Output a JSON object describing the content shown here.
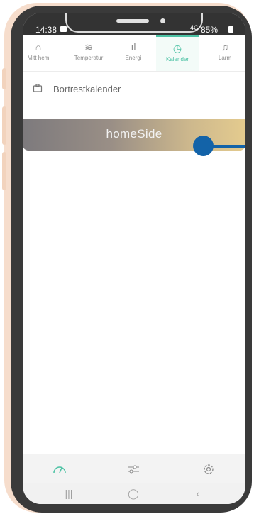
{
  "status_bar": {
    "time": "14:38",
    "signal": "4G",
    "battery": "85%"
  },
  "top_tabs": [
    {
      "label": "Mitt hem",
      "icon": "home-icon"
    },
    {
      "label": "Temperatur",
      "icon": "heat-waves-icon"
    },
    {
      "label": "Energi",
      "icon": "bar-chart-icon"
    },
    {
      "label": "Kalender",
      "icon": "clock-icon",
      "active": true
    },
    {
      "label": "Larm",
      "icon": "bell-icon"
    }
  ],
  "section": {
    "title": "Bortrestkalender",
    "icon": "briefcase-icon"
  },
  "banner": {
    "logo": "homeSide"
  },
  "bottom_nav": [
    {
      "icon": "gauge-icon",
      "glyph": "◜",
      "active": true
    },
    {
      "icon": "sliders-icon",
      "glyph": "⚟"
    },
    {
      "icon": "gear-icon",
      "glyph": "⚙"
    }
  ],
  "system_nav": [
    {
      "icon": "recent-apps-icon",
      "glyph": "|||"
    },
    {
      "icon": "home-button-icon",
      "glyph": "◯"
    },
    {
      "icon": "back-icon",
      "glyph": "‹"
    }
  ],
  "colors": {
    "accent": "#4cc2a4",
    "marker": "#1363a8",
    "phone_frame": "#3a3a3a"
  }
}
